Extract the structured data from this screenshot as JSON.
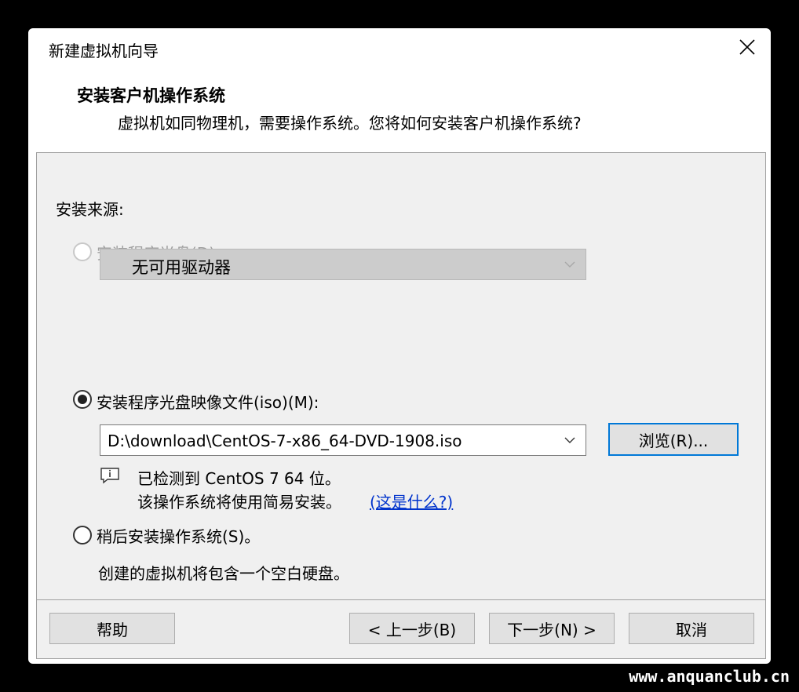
{
  "window": {
    "title": "新建虚拟机向导",
    "close_icon": "close-icon"
  },
  "header": {
    "heading": "安装客户机操作系统",
    "subtitle": "虚拟机如同物理机，需要操作系统。您将如何安装客户机操作系统?"
  },
  "install_source": {
    "label": "安装来源:",
    "options": [
      {
        "label": "安装程序光盘(D):",
        "selected": false,
        "enabled": false
      },
      {
        "label": "安装程序光盘映像文件(iso)(M):",
        "selected": true,
        "enabled": true
      },
      {
        "label": "稍后安装操作系统(S)。",
        "selected": false,
        "enabled": true
      }
    ],
    "disc_drive_value": "无可用驱动器",
    "iso_path_value": "D:\\download\\CentOS-7-x86_64-DVD-1908.iso",
    "browse_label": "浏览(R)...",
    "detect_line1": "已检测到 CentOS 7 64 位。",
    "detect_line2": "该操作系统将使用简易安装。",
    "what_is_this_link": "(这是什么?)",
    "later_description": "创建的虚拟机将包含一个空白硬盘。"
  },
  "footer": {
    "help_label": "帮助",
    "back_label": "< 上一步(B)",
    "next_label": "下一步(N) >",
    "cancel_label": "取消"
  },
  "watermark": "www.anquanclub.cn",
  "colors": {
    "accent": "#0078d7",
    "link": "#0033cc",
    "panel": "#f0f0f0"
  }
}
